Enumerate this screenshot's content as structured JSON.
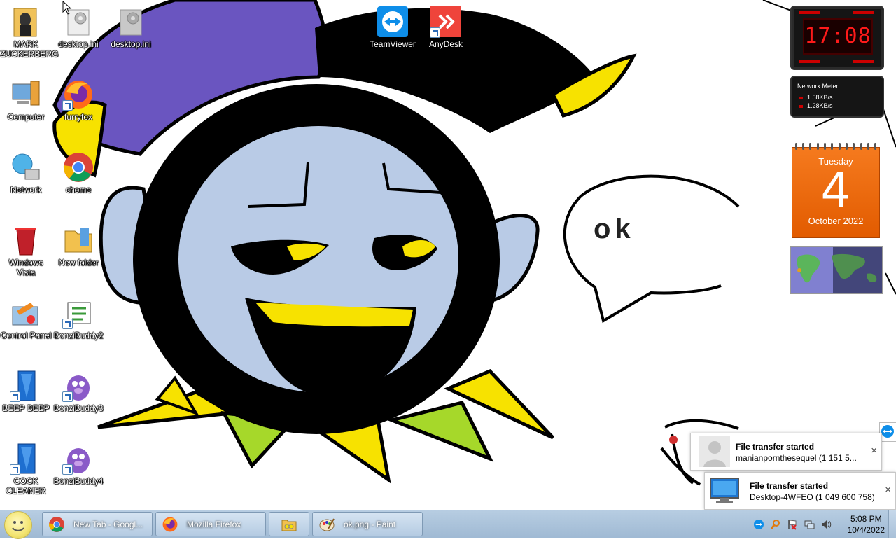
{
  "desktop_icons": [
    {
      "label": "MARK ZUCKERBERG",
      "icon": "folder-person-icon"
    },
    {
      "label": "desktop.ini",
      "icon": "settings-file-icon"
    },
    {
      "label": "desktop.ini",
      "icon": "settings-file-icon"
    },
    {
      "label": "TeamViewer",
      "icon": "teamviewer-icon"
    },
    {
      "label": "AnyDesk",
      "icon": "anydesk-icon"
    },
    {
      "label": "Computer",
      "icon": "computer-icon"
    },
    {
      "label": "furryfox",
      "icon": "firefox-icon"
    },
    {
      "label": "Network",
      "icon": "network-icon"
    },
    {
      "label": "chome",
      "icon": "chrome-icon"
    },
    {
      "label": "Windows Vista",
      "icon": "recycle-bin-icon"
    },
    {
      "label": "New folder",
      "icon": "folder-icon"
    },
    {
      "label": "Control Panel",
      "icon": "control-panel-icon"
    },
    {
      "label": "BonziBuddy2",
      "icon": "media-file-icon"
    },
    {
      "label": "BEEP BEEP",
      "icon": "blue-app-icon"
    },
    {
      "label": "BonziBuddy3",
      "icon": "bonzibuddy-icon"
    },
    {
      "label": "COCK CLEANER",
      "icon": "blue-app-icon"
    },
    {
      "label": "BonziBuddy4",
      "icon": "bonzibuddy-icon"
    }
  ],
  "wallpaper": {
    "speech_text": "ok"
  },
  "gadgets": {
    "clock_time": "17:08",
    "network_meter": {
      "title": "Network Meter",
      "down": "1.58KB/s",
      "up": "1.28KB/s"
    },
    "calendar": {
      "weekday": "Tuesday",
      "day": "4",
      "month_year": "October 2022"
    }
  },
  "notifications": [
    {
      "title": "File transfer started",
      "body": "manianpornthesequel (1 151 5...",
      "close": "×"
    },
    {
      "title": "File transfer started",
      "body": "Desktop-4WFEO (1 049 600 758)",
      "close": "×"
    }
  ],
  "taskbar": {
    "buttons": [
      {
        "label": "New Tab - Googl...",
        "icon": "chrome-icon"
      },
      {
        "label": "Mozilla Firefox",
        "icon": "firefox-icon"
      },
      {
        "label": "",
        "icon": "file-explorer-icon"
      },
      {
        "label": "ok.png - Paint",
        "icon": "paint-icon"
      }
    ],
    "clock_time": "5:08 PM",
    "clock_date": "10/4/2022"
  },
  "colors": {
    "hat_purple": "#6a55c0",
    "face_blue": "#b9cbe6",
    "yellow": "#f7e200",
    "green": "#a6d82a",
    "taskbar": "#a9c2db"
  }
}
